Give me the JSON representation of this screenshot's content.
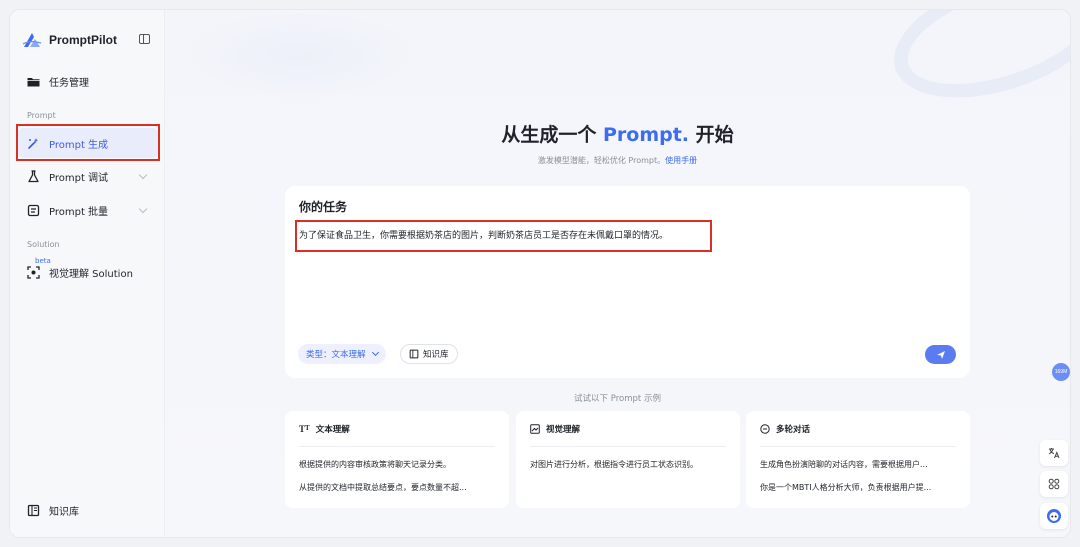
{
  "sidebar": {
    "brand": "PromptPilot",
    "task_management": "任务管理",
    "section_prompt": "Prompt",
    "prompt_generate": "Prompt 生成",
    "prompt_debug": "Prompt 调试",
    "prompt_batch": "Prompt 批量",
    "section_solution": "Solution",
    "beta_badge": "beta",
    "visual_solution": "视觉理解 Solution",
    "knowledge_base": "知识库"
  },
  "hero": {
    "title_prefix": "从生成一个 ",
    "title_accent": "Prompt.",
    "title_suffix": " 开始",
    "subtitle": "激发模型潜能，轻松优化 Prompt。",
    "manual_link": "使用手册"
  },
  "task": {
    "label": "你的任务",
    "text": "为了保证食品卫生，你需要根据奶茶店的图片，判断奶茶店员工是否存在未佩戴口罩的情况。",
    "type_prefix": "类型：",
    "type_value": "文本理解",
    "knowledge_button": "知识库"
  },
  "examples": {
    "label": "试试以下 Prompt 示例",
    "cards": [
      {
        "title": "文本理解",
        "lines": [
          "根据提供的内容审核政策将聊天记录分类。",
          "从提供的文档中提取总结要点，要点数量不超..."
        ]
      },
      {
        "title": "视觉理解",
        "lines": [
          "对图片进行分析，根据指令进行员工状态识别。"
        ]
      },
      {
        "title": "多轮对话",
        "lines": [
          "生成角色扮演陪聊的对话内容，需要根据用户...",
          "你是一个MBTI人格分析大师，负责根据用户提..."
        ]
      }
    ]
  },
  "floating": {
    "badge": "169M"
  },
  "colors": {
    "accent": "#3c6cf0",
    "highlight_border": "#d93025",
    "send_button": "#5a7cf0"
  }
}
